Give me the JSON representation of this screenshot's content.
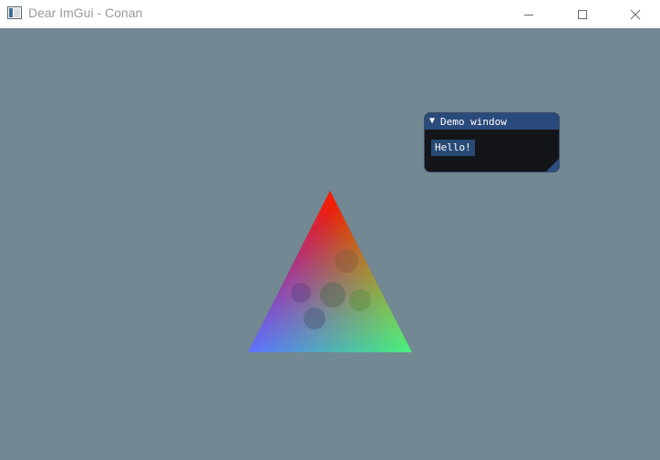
{
  "window": {
    "title": "Dear ImGui - Conan",
    "background_color": "#728893"
  },
  "demo_window": {
    "title": "Demo window",
    "button_label": "Hello!",
    "titlebar_color": "#2a4a7b",
    "body_color": "#141518"
  },
  "scene": {
    "shape": "triangle",
    "vertex_colors": [
      "#ff0000",
      "#00ff00",
      "#0000ff"
    ]
  },
  "icons": {
    "app": "app-window-icon",
    "minimize": "minimize-icon",
    "maximize": "maximize-icon",
    "close": "close-icon",
    "collapse": "collapse-triangle-icon"
  }
}
